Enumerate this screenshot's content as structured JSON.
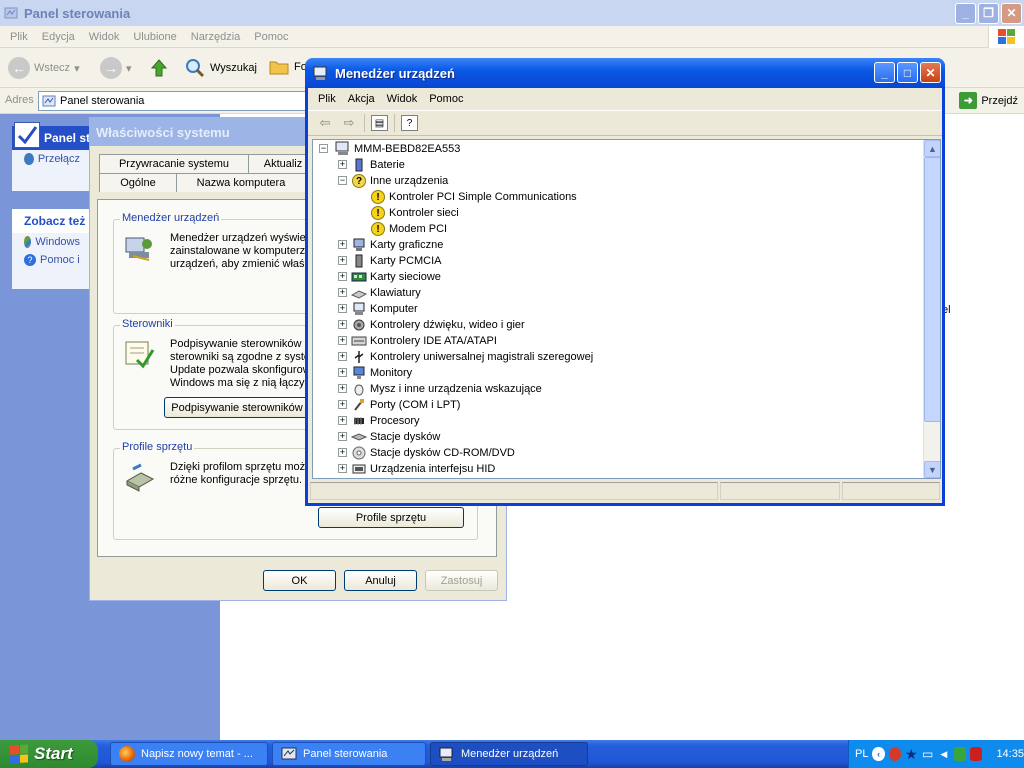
{
  "control_panel": {
    "title": "Panel sterowania",
    "menu": [
      "Plik",
      "Edycja",
      "Widok",
      "Ulubione",
      "Narzędzia",
      "Pomoc"
    ],
    "toolbar": {
      "back": "Wstecz",
      "search": "Wyszukaj",
      "folders": "Fo"
    },
    "address_label": "Adres",
    "address_value": "Panel sterowania",
    "go_label": "Przejdź",
    "left": {
      "box1_title": "Panel st",
      "box1_item": "Przełącz",
      "box2_title": "Zobacz też",
      "box2_items": [
        "Windows",
        "Pomoc i"
      ]
    },
    "right_fragment": "el"
  },
  "system_properties": {
    "title": "Właściwości systemu",
    "tabs_back": [
      "Przywracanie systemu",
      "Aktualiz"
    ],
    "tabs_front": [
      "Ogólne",
      "Nazwa komputera"
    ],
    "device_manager_group": {
      "label": "Menedżer urządzeń",
      "text": "Menedżer urządzeń wyświetl\nzainstalowane w komputerze\nurządzeń, aby zmienić właśc"
    },
    "drivers_group": {
      "label": "Sterowniki",
      "text": "Podpisywanie sterowników z\nsterowniki są zgodne z syster\nUpdate pozwala skonfigurow\nWindows ma się z nią łączyć",
      "button": "Podpisywanie sterowników"
    },
    "hw_profiles_group": {
      "label": "Profile sprzętu",
      "text": "Dzięki profilom sprzętu możes\nróżne konfiguracje sprzętu.",
      "button": "Profile sprzętu"
    },
    "buttons": {
      "ok": "OK",
      "cancel": "Anuluj",
      "apply": "Zastosuj"
    }
  },
  "device_manager": {
    "title": "Menedżer urządzeń",
    "menu": [
      "Plik",
      "Akcja",
      "Widok",
      "Pomoc"
    ],
    "tree": {
      "root": "MMM-BEBD82EA553",
      "items": [
        {
          "label": "Baterie",
          "level": 1,
          "expander": "+",
          "icon": "battery-icon"
        },
        {
          "label": "Inne urządzenia",
          "level": 1,
          "expander": "-",
          "icon": "unknown-device-icon"
        },
        {
          "label": "Kontroler PCI Simple Communications",
          "level": 2,
          "expander": "",
          "icon": "warning-icon"
        },
        {
          "label": "Kontroler sieci",
          "level": 2,
          "expander": "",
          "icon": "warning-icon"
        },
        {
          "label": "Modem PCI",
          "level": 2,
          "expander": "",
          "icon": "warning-icon"
        },
        {
          "label": "Karty graficzne",
          "level": 1,
          "expander": "+",
          "icon": "display-adapter-icon"
        },
        {
          "label": "Karty PCMCIA",
          "level": 1,
          "expander": "+",
          "icon": "pcmcia-icon"
        },
        {
          "label": "Karty sieciowe",
          "level": 1,
          "expander": "+",
          "icon": "network-card-icon"
        },
        {
          "label": "Klawiatury",
          "level": 1,
          "expander": "+",
          "icon": "keyboard-icon"
        },
        {
          "label": "Komputer",
          "level": 1,
          "expander": "+",
          "icon": "computer-icon"
        },
        {
          "label": "Kontrolery dźwięku, wideo i gier",
          "level": 1,
          "expander": "+",
          "icon": "sound-icon"
        },
        {
          "label": "Kontrolery IDE ATA/ATAPI",
          "level": 1,
          "expander": "+",
          "icon": "ide-icon"
        },
        {
          "label": "Kontrolery uniwersalnej magistrali szeregowej",
          "level": 1,
          "expander": "+",
          "icon": "usb-icon"
        },
        {
          "label": "Monitory",
          "level": 1,
          "expander": "+",
          "icon": "monitor-icon"
        },
        {
          "label": "Mysz i inne urządzenia wskazujące",
          "level": 1,
          "expander": "+",
          "icon": "mouse-icon"
        },
        {
          "label": "Porty (COM i LPT)",
          "level": 1,
          "expander": "+",
          "icon": "port-icon"
        },
        {
          "label": "Procesory",
          "level": 1,
          "expander": "+",
          "icon": "processor-icon"
        },
        {
          "label": "Stacje dysków",
          "level": 1,
          "expander": "+",
          "icon": "disk-drive-icon"
        },
        {
          "label": "Stacje dysków CD-ROM/DVD",
          "level": 1,
          "expander": "+",
          "icon": "cdrom-icon"
        },
        {
          "label": "Urządzenia interfejsu HID",
          "level": 1,
          "expander": "+",
          "icon": "hid-icon"
        }
      ]
    }
  },
  "taskbar": {
    "start_label": "Start",
    "tasks": [
      {
        "label": "Napisz nowy temat - ...",
        "icon": "firefox-icon",
        "active": false
      },
      {
        "label": "Panel sterowania",
        "icon": "control-panel-icon",
        "active": false
      },
      {
        "label": "Menedżer urządzeń",
        "icon": "device-manager-icon",
        "active": true
      }
    ],
    "tray": {
      "language": "PL",
      "clock": "14:35"
    }
  }
}
